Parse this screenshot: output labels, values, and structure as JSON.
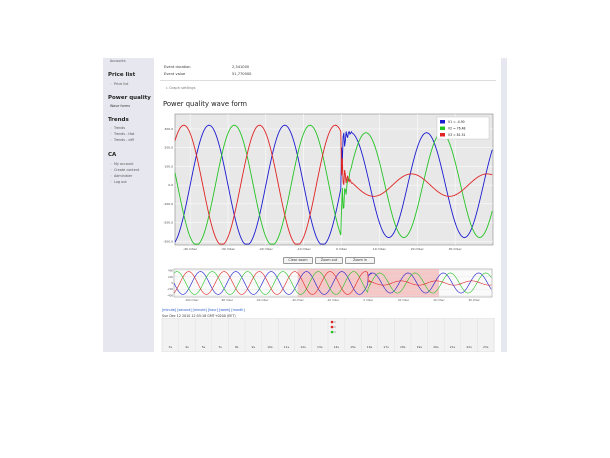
{
  "sidebar": {
    "top_link": "Accounts",
    "sections": [
      {
        "title": "Price list",
        "items": [
          "Price list"
        ]
      },
      {
        "title": "Power quality",
        "items": [
          "Wave forms"
        ]
      },
      {
        "title": "Trends",
        "items": [
          "Trends",
          "Trends - tfat",
          "Trends - diff"
        ]
      },
      {
        "title": "CA",
        "items": [
          "My account",
          "Create content",
          "Administer",
          "Log out"
        ]
      }
    ]
  },
  "event": {
    "duration_label": "Event duration",
    "duration_value": "2,341000",
    "value_label": "Event value",
    "value_value": "51,770000"
  },
  "graph_settings_label": "Graph settings",
  "page_title": "Power quality wave form",
  "legend": [
    {
      "label": "V1 = -4.90",
      "color": "#1c1cd0"
    },
    {
      "label": "V2 = 76.48",
      "color": "#25c425"
    },
    {
      "label": "V3 = 81.51",
      "color": "#e02424"
    }
  ],
  "buttons": {
    "clear_zoom": "Clear zoom",
    "zoom_out": "Zoom out",
    "zoom": "Zoom in"
  },
  "timeline": {
    "links": "[minute] [second] [minute] [hour] [week] [month]",
    "date": "Sun Dec 12 2010 12:55:18 GMT+0200 (EET)",
    "ticks": [
      "3s",
      "4s",
      "5s",
      "7s",
      "8s",
      "9s",
      "10s",
      "11s",
      "12s",
      "13s",
      "14s",
      "15s",
      "16s",
      "17s",
      "18s",
      "19s",
      "20s",
      "21s",
      "22s",
      "23s"
    ]
  },
  "chart_data": {
    "type": "line",
    "title": "Power quality wave form",
    "xlabel": "",
    "ylabel": "",
    "y_ticks": [
      "300.0",
      "200.0",
      "100.0",
      "0.0",
      "-100.0",
      "-200.0",
      "-300.0"
    ],
    "x_ticks": [
      "-40 mSec",
      "-30 mSec",
      "-20 mSec",
      "-10 mSec",
      "0 mSec",
      "10 mSec",
      "20 mSec",
      "30 mSec"
    ],
    "ylim": [
      -320,
      380
    ],
    "xlim": [
      -44,
      40
    ],
    "grid": true,
    "legend_position": "top-right",
    "series": [
      {
        "name": "V1 = -4.90",
        "color": "#1c1cd0",
        "amplitude_pre": 320,
        "amplitude_post": 280,
        "phase": 0
      },
      {
        "name": "V2 = 76.48",
        "color": "#25c425",
        "amplitude_pre": 320,
        "amplitude_post": 280,
        "phase": -120
      },
      {
        "name": "V3 = 81.51",
        "color": "#e02424",
        "amplitude_pre": 320,
        "amplitude_post": 60,
        "phase": 120
      }
    ],
    "event_time": 0,
    "period_ms": 20,
    "overview": {
      "x_ticks": [
        "-100 mSec",
        "-80 mSec",
        "-60 mSec",
        "-40 mSec",
        "-20 mSec",
        "0 mSec",
        "20 mSec",
        "40 mSec",
        "60 mSec"
      ],
      "y_ticks": [
        "400",
        "200",
        "0",
        "-200",
        "-400"
      ],
      "highlight": [
        -40,
        40
      ]
    }
  }
}
